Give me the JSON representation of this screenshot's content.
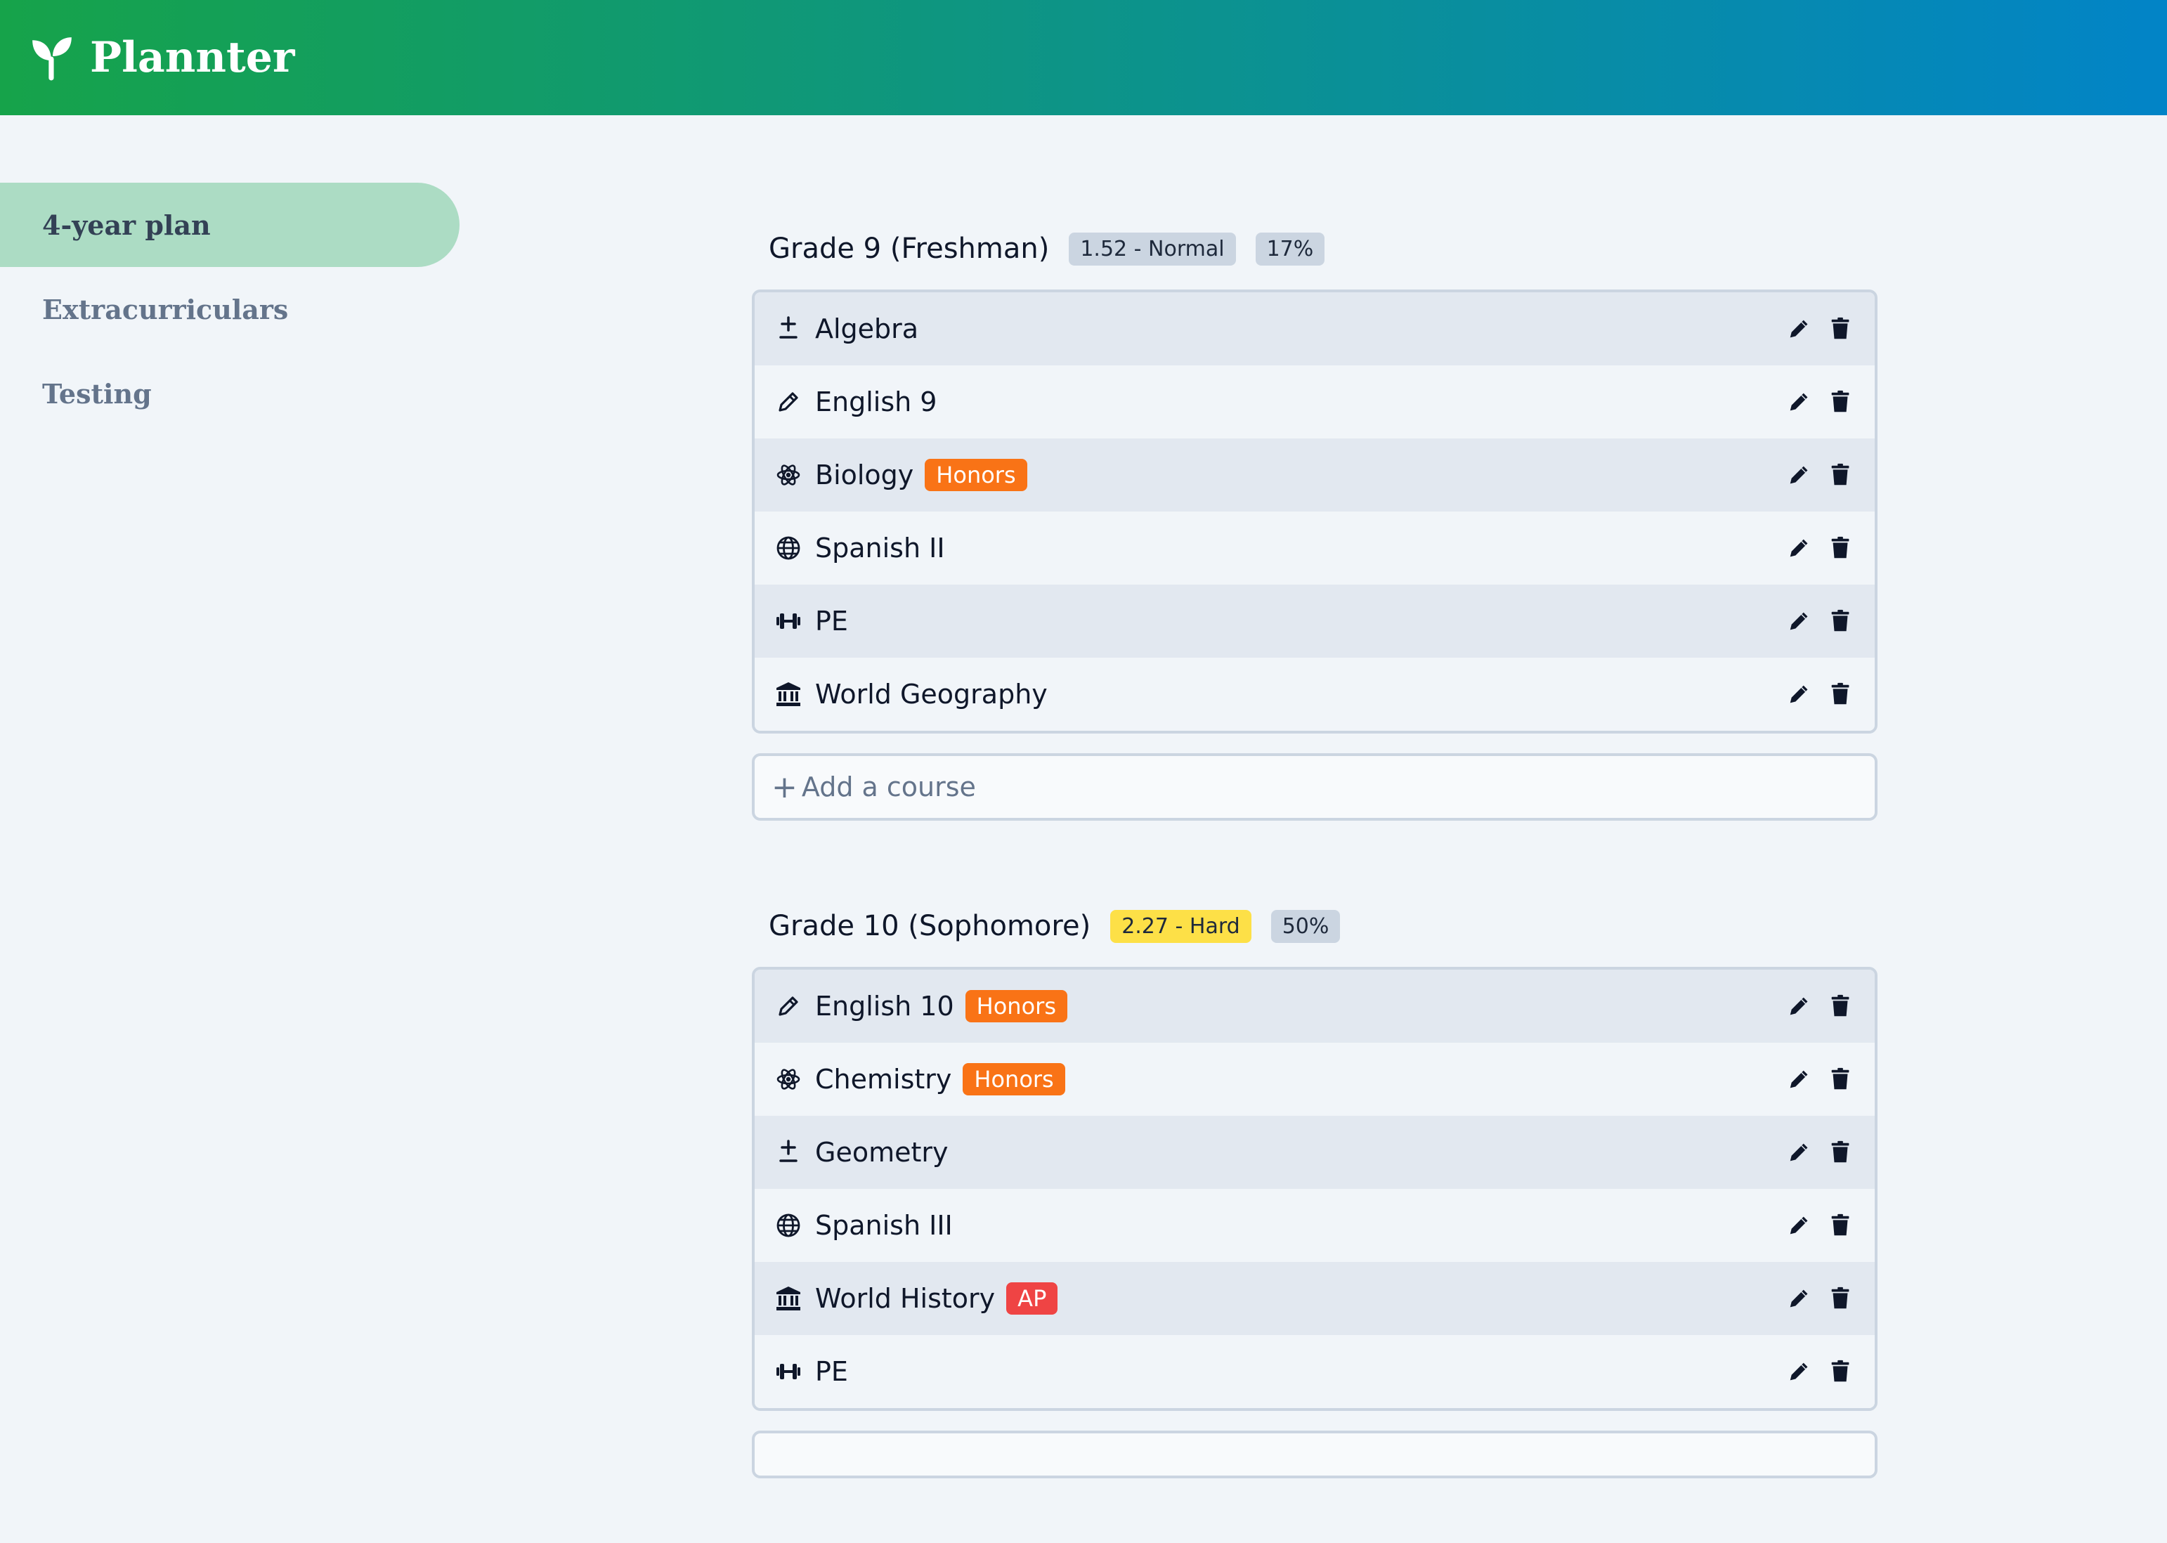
{
  "app": {
    "name": "Plannter",
    "logo_icon": "sprout-icon",
    "colors": {
      "header_start": "#16a34a",
      "header_end": "#0284c7",
      "nav_active": "#acdcc4",
      "honors": "#f97316",
      "ap": "#ef4444",
      "hard": "#fde047",
      "normal": "#cbd5e1"
    }
  },
  "sidebar": {
    "items": [
      {
        "label": "4-year plan",
        "active": true
      },
      {
        "label": "Extracurriculars",
        "active": false
      },
      {
        "label": "Testing",
        "active": false
      }
    ]
  },
  "years": [
    {
      "title": "Grade 9 (Freshman)",
      "difficulty": "1.52 - Normal",
      "percent": "17%",
      "courses": [
        {
          "name": "Algebra",
          "icon": "plus-minus-icon",
          "tag": ""
        },
        {
          "name": "English 9",
          "icon": "pencil-icon",
          "tag": ""
        },
        {
          "name": "Biology",
          "icon": "atom-icon",
          "tag": "Honors"
        },
        {
          "name": "Spanish II",
          "icon": "globe-icon",
          "tag": ""
        },
        {
          "name": "PE",
          "icon": "dumbbell-icon",
          "tag": ""
        },
        {
          "name": "World Geography",
          "icon": "landmark-icon",
          "tag": ""
        }
      ],
      "add_label": "Add a course"
    },
    {
      "title": "Grade 10 (Sophomore)",
      "difficulty": "2.27 - Hard",
      "percent": "50%",
      "courses": [
        {
          "name": "English 10",
          "icon": "pencil-icon",
          "tag": "Honors"
        },
        {
          "name": "Chemistry",
          "icon": "atom-icon",
          "tag": "Honors"
        },
        {
          "name": "Geometry",
          "icon": "plus-minus-icon",
          "tag": ""
        },
        {
          "name": "Spanish III",
          "icon": "globe-icon",
          "tag": ""
        },
        {
          "name": "World History",
          "icon": "landmark-icon",
          "tag": "AP"
        },
        {
          "name": "PE",
          "icon": "dumbbell-icon",
          "tag": ""
        }
      ]
    }
  ]
}
